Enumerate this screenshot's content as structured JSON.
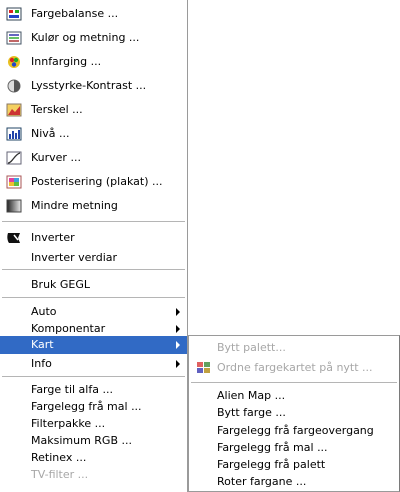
{
  "main_menu": {
    "items": [
      {
        "label": "Fargebalanse ...",
        "icon": "color-balance-icon"
      },
      {
        "label": "Kulør og metning ...",
        "icon": "hue-saturation-icon"
      },
      {
        "label": "Innfarging ...",
        "icon": "colorize-icon"
      },
      {
        "label": "Lysstyrke-Kontrast ...",
        "icon": "brightness-contrast-icon"
      },
      {
        "label": "Terskel ...",
        "icon": "threshold-icon"
      },
      {
        "label": "Nivå ...",
        "icon": "levels-icon"
      },
      {
        "label": "Kurver ...",
        "icon": "curves-icon"
      },
      {
        "label": "Posterisering (plakat) ...",
        "icon": "posterize-icon"
      },
      {
        "label": "Mindre metning",
        "icon": "desaturate-icon"
      },
      {
        "label": "Inverter",
        "icon": "invert-icon"
      },
      {
        "label": "Inverter verdiar"
      },
      {
        "label": "Bruk GEGL"
      },
      {
        "label": "Auto"
      },
      {
        "label": "Komponentar"
      },
      {
        "label": "Kart"
      },
      {
        "label": "Info"
      },
      {
        "label": "Farge til alfa ..."
      },
      {
        "label": "Fargelegg frå mal ..."
      },
      {
        "label": "Filterpakke ..."
      },
      {
        "label": "Maksimum RGB ..."
      },
      {
        "label": "Retinex ..."
      },
      {
        "label": "TV-filter ..."
      }
    ]
  },
  "sub_menu": {
    "items": [
      {
        "label": "Bytt palett..."
      },
      {
        "label": "Ordne fargekartet på nytt ...",
        "icon": "rearrange-colormap-icon"
      },
      {
        "label": "Alien Map ..."
      },
      {
        "label": "Bytt farge ..."
      },
      {
        "label": "Fargelegg frå fargeovergang"
      },
      {
        "label": "Fargelegg frå mal ..."
      },
      {
        "label": "Fargelegg frå palett"
      },
      {
        "label": "Roter fargane ..."
      }
    ]
  },
  "colors": {
    "selection": "#316ac5",
    "disabled_text": "#a7a7a7",
    "separator": "#b5b5b5"
  }
}
